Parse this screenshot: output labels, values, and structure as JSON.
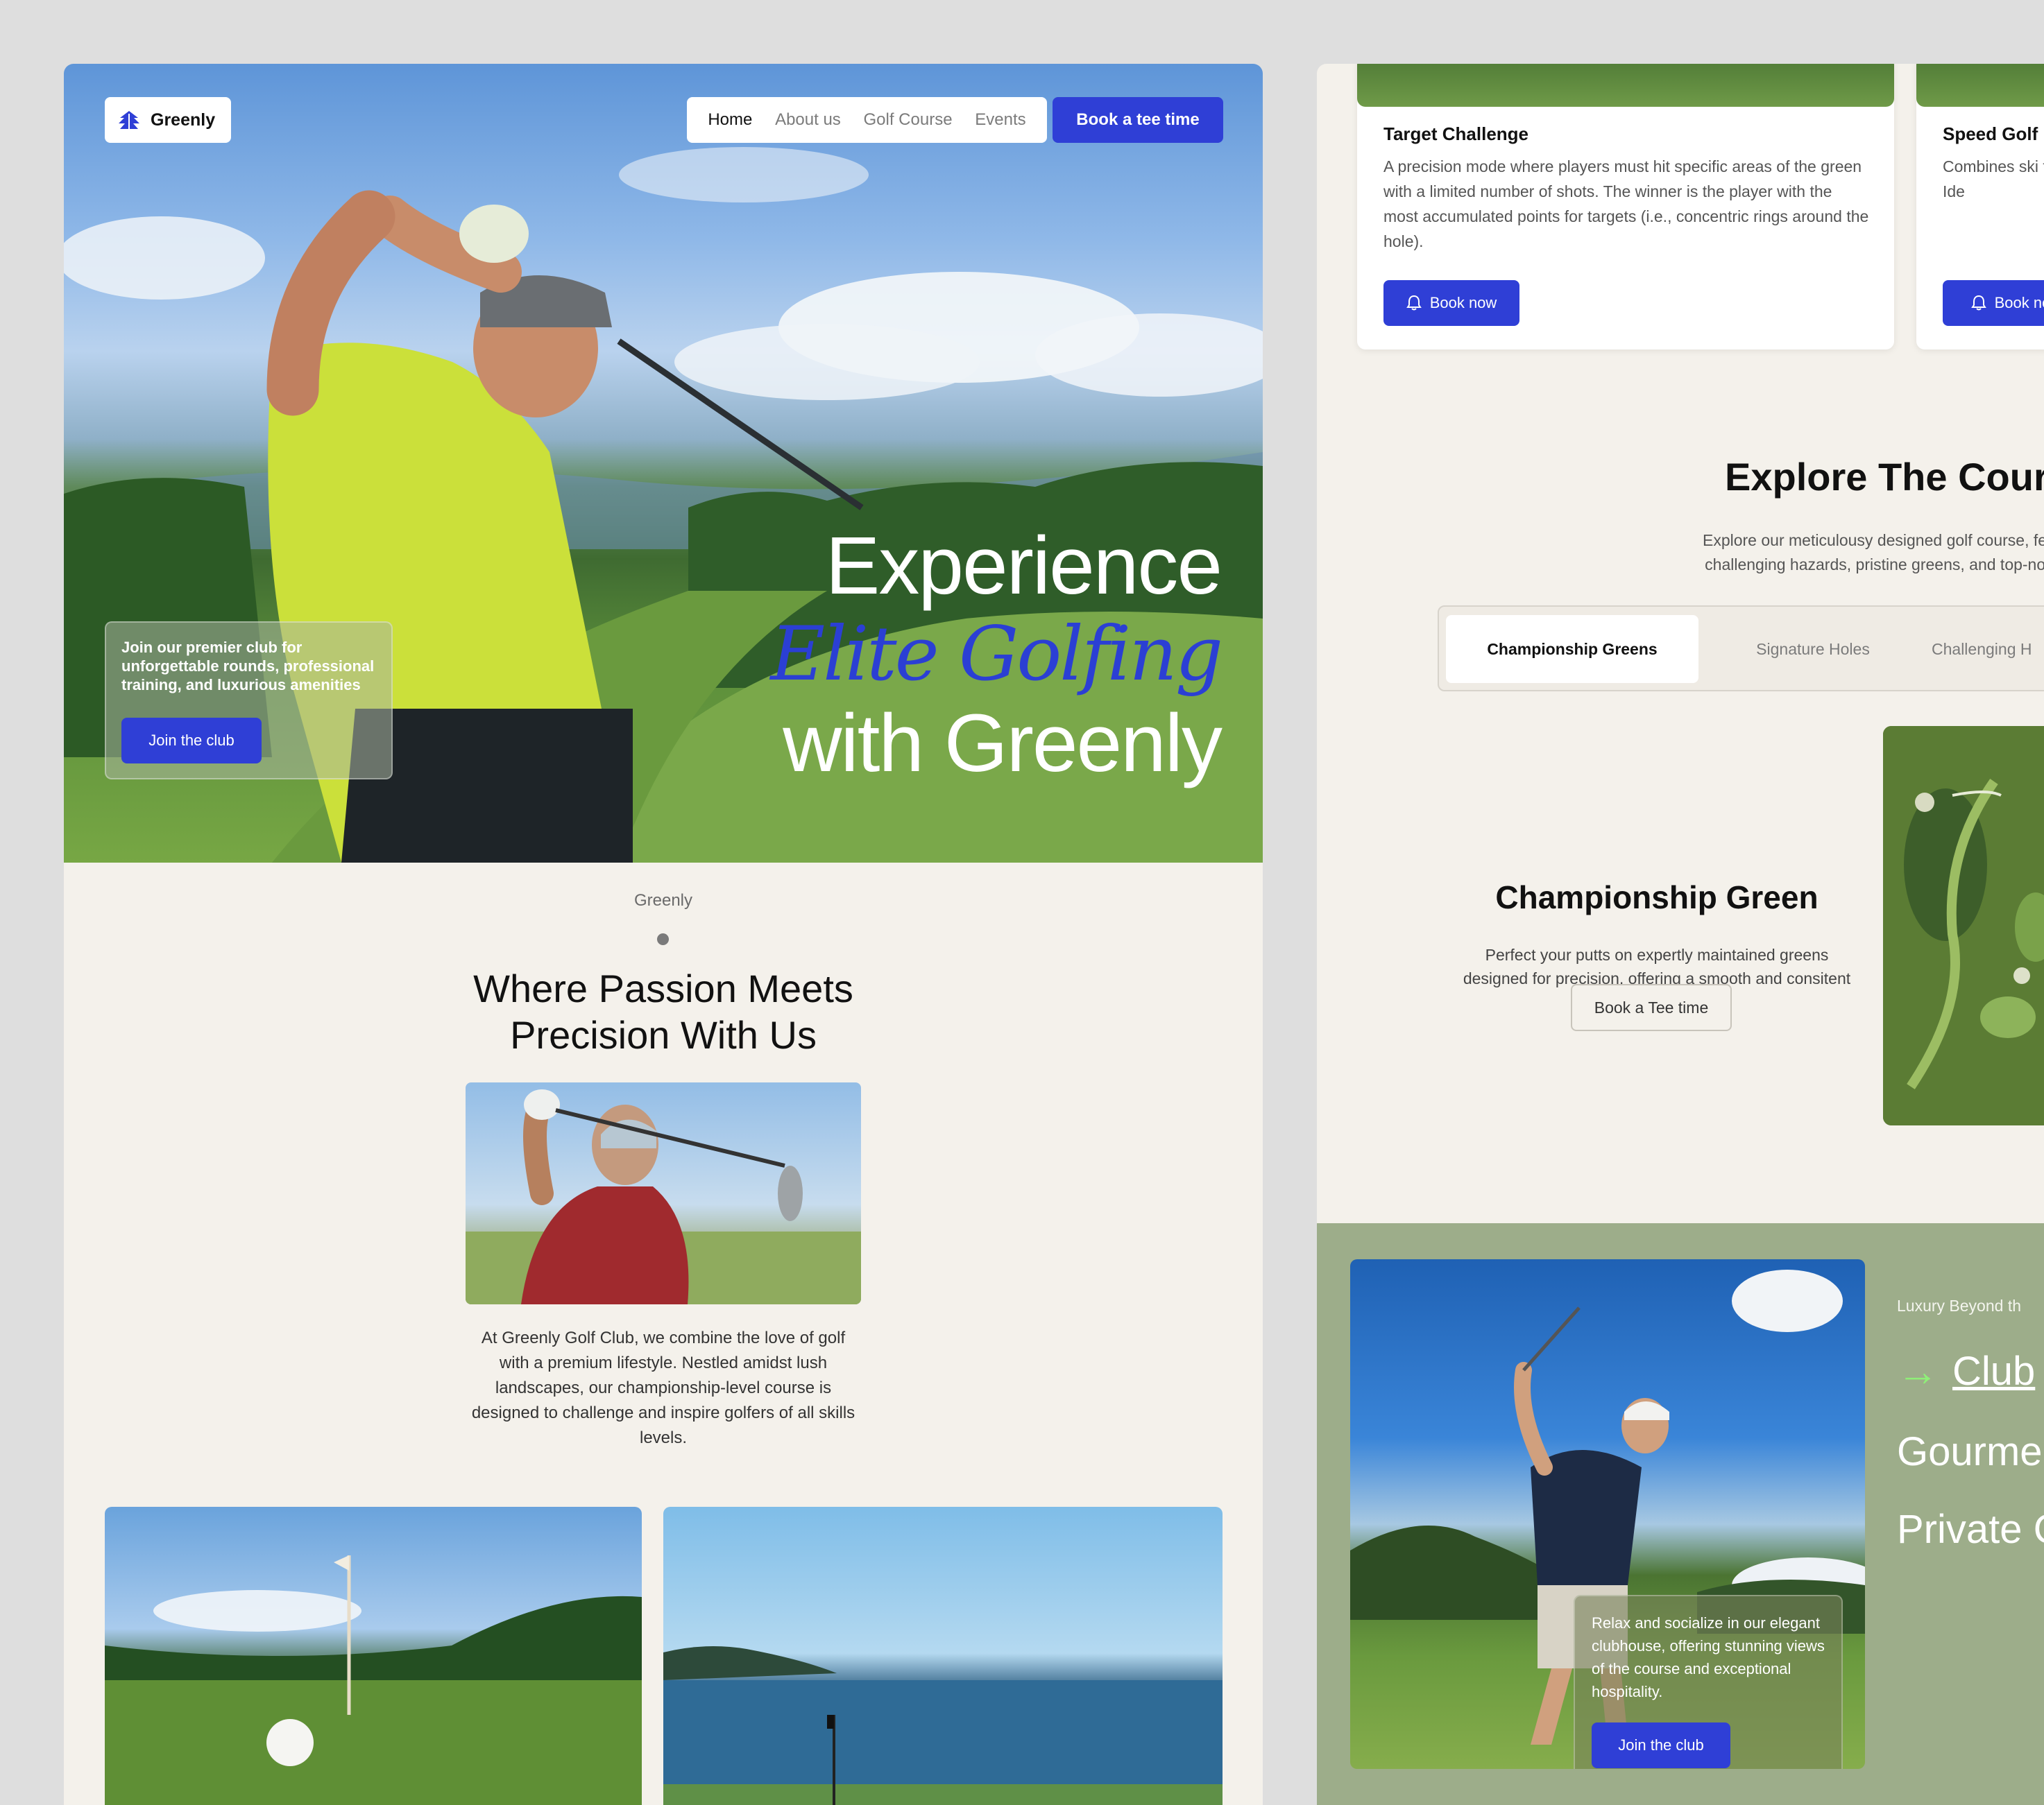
{
  "left": {
    "logo": {
      "brand": "Greenly",
      "icon": "pine-tree-icon"
    },
    "nav": {
      "items": [
        "Home",
        "About us",
        "Golf Course",
        "Events"
      ],
      "active": "Home"
    },
    "book_tee_label": "Book a tee time",
    "hero": {
      "line1": "Experience",
      "line2": "Elite Golfing",
      "line3": "with Greenly"
    },
    "join_card": {
      "text": "Join our premier club for unforgettable rounds, professional training, and luxurious amenities",
      "button": "Join the club"
    },
    "about": {
      "label": "Greenly",
      "title_line1": "Where Passion Meets",
      "title_line2": "Precision With Us",
      "paragraph": "At Greenly Golf Club, we combine the love of golf with a premium lifestyle. Nestled amidst lush landscapes, our championship-level course is designed to challenge and  inspire golfers of all skills levels."
    }
  },
  "right": {
    "events": [
      {
        "title": "Target Challenge",
        "desc": "A precision mode where players must hit specific areas of the green with a limited number of shots. The winner is the player with the most accumulated points for targets (i.e., concentric rings around the hole).",
        "button": "Book now"
      },
      {
        "title": "Speed Golf",
        "desc": "Combines ski time possible final time. Ide",
        "button": "Book no"
      }
    ],
    "explore": {
      "title": "Explore The Cour",
      "desc_line1": "Explore our meticulousy designed golf course, featu",
      "desc_line2": "challenging hazards, pristine greens, and top-notch",
      "tabs": [
        "Championship Greens",
        "Signature Holes",
        "Challenging H"
      ],
      "active_tab": "Championship Greens",
      "panel_title": "Championship Green",
      "panel_desc": "Perfect your putts on expertly maintained greens designed for precision, offering a smooth and consitent playing experience",
      "panel_button": "Book a Tee time"
    },
    "club": {
      "card_text": "Relax and socialize in our elegant clubhouse, offering stunning views of the course and exceptional hospitality.",
      "card_button": "Join the club",
      "label": "Luxury Beyond th",
      "highlight": "Club",
      "items": [
        "Gourme",
        "Private C"
      ]
    }
  },
  "colors": {
    "accent_blue": "#2f3fd6",
    "page_bg": "#f4f1eb",
    "outer_bg": "#dedede",
    "club_section_bg": "#9dad8a",
    "arrow_green": "#8ff078"
  }
}
